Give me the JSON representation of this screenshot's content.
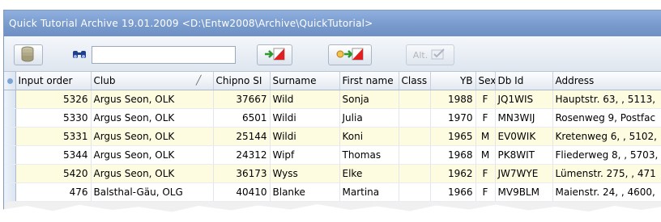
{
  "window": {
    "title": "Quick Tutorial Archive  19.01.2009  <D:\\Entw2008\\Archive\\QuickTutorial>"
  },
  "toolbar": {
    "db_icon": "database-icon",
    "search_icon": "binoculars-icon",
    "search_value": "",
    "import_icon": "arrow-into-flag-icon",
    "transfer_icon": "circle-arrow-flag-icon",
    "alt_label": "Alt.",
    "alt_icon": "check-box-icon"
  },
  "table": {
    "columns": [
      "Input order",
      "Club",
      "Chipno SI",
      "Surname",
      "First name",
      "Class",
      "YB",
      "Sex",
      "Db Id",
      "Address"
    ],
    "rows": [
      {
        "input_order": "5326",
        "club": "Argus Seon, OLK",
        "chipno": "37667",
        "surname": "Wild",
        "first_name": "Sonja",
        "class": "",
        "yb": "1988",
        "sex": "F",
        "db_id": "JQ1WIS",
        "address": "Hauptstr. 63, , 5113,"
      },
      {
        "input_order": "5330",
        "club": "Argus Seon, OLK",
        "chipno": "6501",
        "surname": "Wildi",
        "first_name": "Julia",
        "class": "",
        "yb": "1970",
        "sex": "F",
        "db_id": "MN3WIJ",
        "address": "Rosenweg 9, Postfac"
      },
      {
        "input_order": "5331",
        "club": "Argus Seon, OLK",
        "chipno": "25144",
        "surname": "Wildi",
        "first_name": "Koni",
        "class": "",
        "yb": "1965",
        "sex": "M",
        "db_id": "EV0WIK",
        "address": "Kretenweg 6, , 5102,"
      },
      {
        "input_order": "5344",
        "club": "Argus Seon, OLK",
        "chipno": "24312",
        "surname": "Wipf",
        "first_name": "Thomas",
        "class": "",
        "yb": "1968",
        "sex": "M",
        "db_id": "PK8WIT",
        "address": "Fliederweg 8, , 5703,"
      },
      {
        "input_order": "5420",
        "club": "Argus Seon, OLK",
        "chipno": "36173",
        "surname": "Wyss",
        "first_name": "Elke",
        "class": "",
        "yb": "1962",
        "sex": "F",
        "db_id": "JW7WYE",
        "address": "Lümenstr. 275, , 471"
      },
      {
        "input_order": "476",
        "club": "Balsthal-Gäu, OLG",
        "chipno": "40410",
        "surname": "Blanke",
        "first_name": "Martina",
        "class": "",
        "yb": "1966",
        "sex": "F",
        "db_id": "MV9BLM",
        "address": "Maienstr. 24, , 4600,"
      }
    ]
  },
  "colors": {
    "titlebar": "#7799cc",
    "row_highlight": "#fdfbe0",
    "flag_red": "#e02020",
    "flag_arrow_green": "#2e9a2e"
  }
}
